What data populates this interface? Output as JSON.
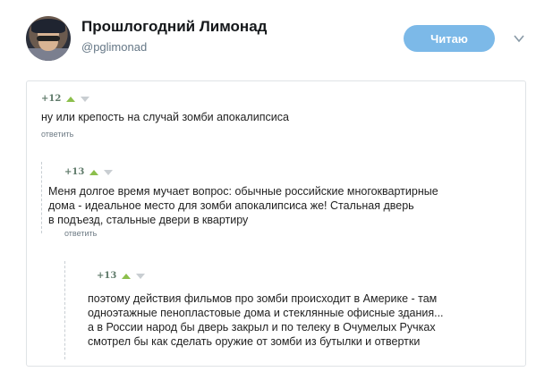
{
  "profile": {
    "name": "Прошлогодний Лимонад",
    "handle": "@pglimonad",
    "follow_label": "Читаю"
  },
  "colors": {
    "follow_button": "#7cb9e8",
    "upvote": "#8cbf4c",
    "downvote": "#c9ced2",
    "card_border": "#dfe3e6"
  },
  "comments": [
    {
      "score": "+12",
      "lines": [
        "ну или крепость на случай зомби апокалипсиса"
      ],
      "reply": "ответить"
    },
    {
      "score": "+13",
      "lines": [
        "Меня долгое время мучает вопрос: обычные российские многоквартирные",
        "дома - идеальное место для зомби апокалипсиса же! Стальная дверь",
        "в подъезд, стальные двери в квартиру"
      ],
      "reply": "ответить"
    },
    {
      "score": "+13",
      "lines": [
        "поэтому действия фильмов про зомби происходит в Америке - там",
        "одноэтажные пенопластовые дома и стеклянные офисные здания...",
        "а в России народ бы дверь закрыл и по телеку в Очумелых Ручках",
        "смотрел бы как сделать оружие от зомби из бутылки и отвертки"
      ]
    }
  ]
}
